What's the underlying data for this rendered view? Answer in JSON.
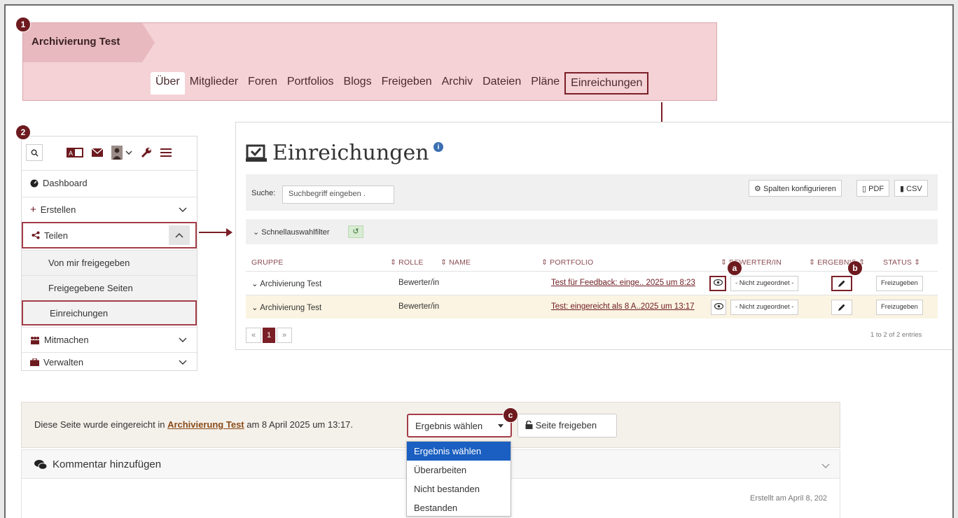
{
  "markers": [
    "1",
    "2",
    "a",
    "b",
    "c"
  ],
  "group": {
    "title": "Archivierung Test",
    "nav": [
      "Über",
      "Mitglieder",
      "Foren",
      "Portfolios",
      "Blogs",
      "Freigeben",
      "Archiv",
      "Dateien",
      "Pläne",
      "Einreichungen"
    ]
  },
  "sidebar": {
    "icons": [
      "search-icon",
      "language-icon",
      "mail-icon",
      "user-icon",
      "chevron-down-icon",
      "wrench-icon",
      "menu-icon"
    ],
    "items": [
      {
        "label": "Dashboard",
        "icon": "dashboard-icon"
      },
      {
        "label": "Erstellen",
        "icon": "plus-icon"
      },
      {
        "label": "Teilen",
        "icon": "share-icon"
      },
      {
        "label": "Von mir freigegeben"
      },
      {
        "label": "Freigegebene Seiten"
      },
      {
        "label": "Einreichungen"
      },
      {
        "label": "Mitmachen",
        "icon": "people-icon"
      },
      {
        "label": "Verwalten",
        "icon": "briefcase-icon"
      }
    ]
  },
  "submissions": {
    "title": "Einreichungen",
    "search_label": "Suche:",
    "search_placeholder": "Suchbegriff eingeben .",
    "config_button": "Spalten konfigurieren",
    "pdf_button": "PDF",
    "csv_button": "CSV",
    "filter_label": "Schnellauswahlfilter",
    "columns": [
      "GRUPPE",
      "ROLLE",
      "NAME",
      "PORTFOLIO",
      "BEWERTER/IN",
      "ERGEBNIS",
      "STATUS"
    ],
    "rows": [
      {
        "group": "Archivierung Test",
        "role": "Bewerter/in",
        "portfolio": "Test für Feedback: einge.. 2025 um 8:23",
        "assessor": "- Nicht zugeordnet -",
        "status": "Freizugeben"
      },
      {
        "group": "Archivierung Test",
        "role": "Bewerter/in",
        "portfolio": "Test: eingereicht als 8 A..2025 um 13:17",
        "assessor": "- Nicht zugeordnet -",
        "status": "Freizugeben"
      }
    ],
    "pagination": {
      "prev": "«",
      "current": "1",
      "next": "»"
    },
    "entries": "1 to 2 of 2 entries"
  },
  "bottom": {
    "text_prefix": "Diese Seite wurde eingereicht in",
    "group_link": "Archivierung Test",
    "text_suffix": "am 8 April 2025 um 13:17.",
    "select_value": "Ergebnis wählen",
    "release_button": "Seite freigeben",
    "comment_label": "Kommentar hinzufügen",
    "created": "Erstellt am April 8, 202",
    "options": [
      "Ergebnis wählen",
      "Überarbeiten",
      "Nicht bestanden",
      "Bestanden"
    ]
  }
}
